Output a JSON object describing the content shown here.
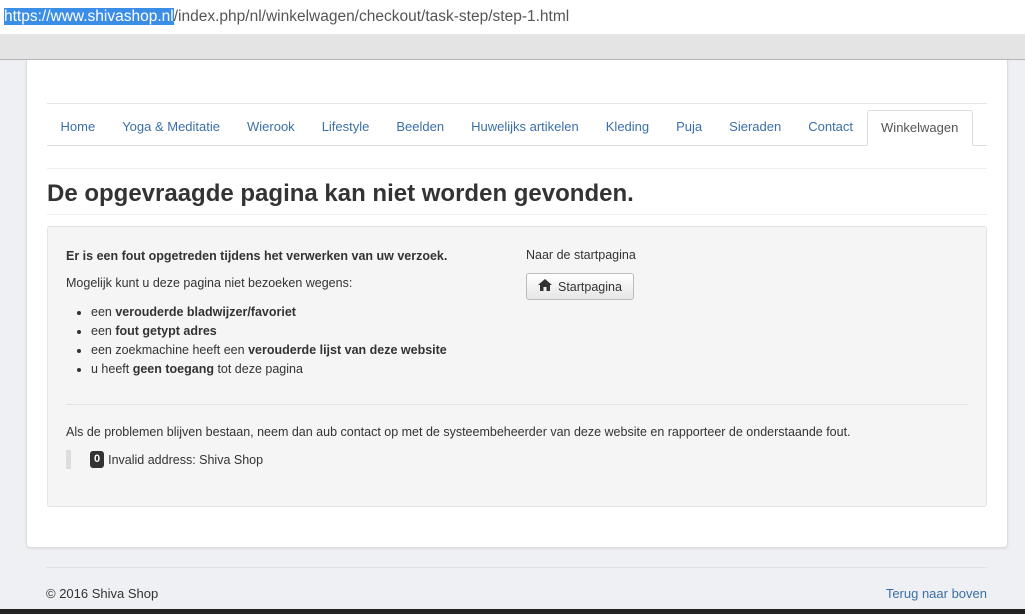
{
  "browser": {
    "url_selected": "https://www.shivashop.nl",
    "url_rest": "/index.php/nl/winkelwagen/checkout/task-step/step-1.html"
  },
  "nav": {
    "items": [
      "Home",
      "Yoga & Meditatie",
      "Wierook",
      "Lifestyle",
      "Beelden",
      "Huwelijks artikelen",
      "Kleding",
      "Puja",
      "Sieraden",
      "Contact",
      "Winkelwagen"
    ],
    "active": "Winkelwagen"
  },
  "page": {
    "title": "De opgevraagde pagina kan niet worden gevonden."
  },
  "error": {
    "heading": "Er is een fout opgetreden tijdens het verwerken van uw verzoek.",
    "intro": "Mogelijk kunt u deze pagina niet bezoeken wegens:",
    "reasons": [
      {
        "pre": "een ",
        "bold": "verouderde bladwijzer/favoriet",
        "post": ""
      },
      {
        "pre": "een ",
        "bold": "fout getypt adres",
        "post": ""
      },
      {
        "pre": "een zoekmachine heeft een ",
        "bold": "verouderde lijst van deze website",
        "post": ""
      },
      {
        "pre": "u heeft ",
        "bold": "geen toegang",
        "post": " tot deze pagina"
      }
    ],
    "home_label": "Naar de startpagina",
    "home_button": "Startpagina",
    "contact_text": "Als de problemen blijven bestaan, neem dan aub contact op met de systeembeheerder van deze website en rapporteer de onderstaande fout.",
    "code": "0",
    "message": "Invalid address: Shiva Shop"
  },
  "footer": {
    "copyright": "© 2016 Shiva Shop",
    "back_to_top": "Terug naar boven"
  },
  "icons": {
    "home_button_icon": "home-icon"
  }
}
